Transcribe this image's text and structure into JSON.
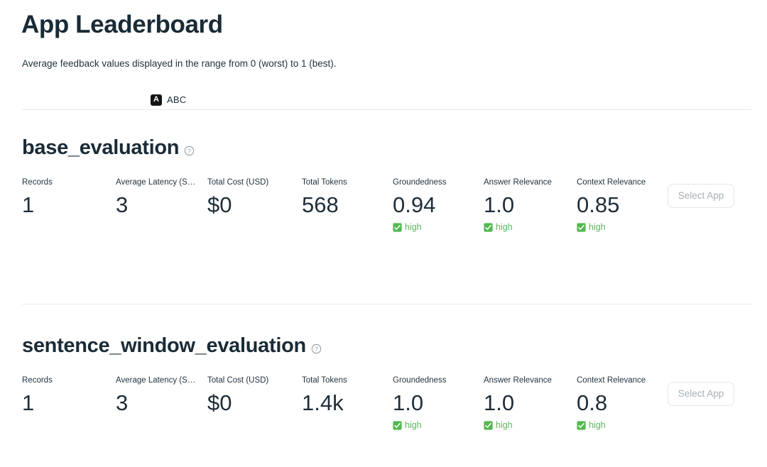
{
  "header": {
    "title": "App Leaderboard",
    "subtitle": "Average feedback values displayed in the range from 0 (worst) to 1 (best)."
  },
  "tabs": [
    {
      "badge": "A",
      "label": "ABC"
    }
  ],
  "colors": {
    "heading": "#1a2b36",
    "text": "#1f2d38",
    "positive": "#5bb85c",
    "muted": "#a7b0b6",
    "divider": "#ebebed",
    "badge_bg": "#121619"
  },
  "buttons": {
    "select_app": "Select App"
  },
  "icons": {
    "help": "help-circle-icon",
    "check": "white-heavy-check-mark-icon"
  },
  "apps": [
    {
      "name": "base_evaluation",
      "metrics": [
        {
          "label": "Records",
          "value": "1",
          "delta": null
        },
        {
          "label": "Average Latency (S…",
          "value": "3",
          "delta": null
        },
        {
          "label": "Total Cost (USD)",
          "value": "$0",
          "delta": null
        },
        {
          "label": "Total Tokens",
          "value": "568",
          "delta": null
        },
        {
          "label": "Groundedness",
          "value": "0.94",
          "delta": "high"
        },
        {
          "label": "Answer Relevance",
          "value": "1.0",
          "delta": "high"
        },
        {
          "label": "Context Relevance",
          "value": "0.85",
          "delta": "high"
        }
      ]
    },
    {
      "name": "sentence_window_evaluation",
      "metrics": [
        {
          "label": "Records",
          "value": "1",
          "delta": null
        },
        {
          "label": "Average Latency (S…",
          "value": "3",
          "delta": null
        },
        {
          "label": "Total Cost (USD)",
          "value": "$0",
          "delta": null
        },
        {
          "label": "Total Tokens",
          "value": "1.4k",
          "delta": null
        },
        {
          "label": "Groundedness",
          "value": "1.0",
          "delta": "high"
        },
        {
          "label": "Answer Relevance",
          "value": "1.0",
          "delta": "high"
        },
        {
          "label": "Context Relevance",
          "value": "0.8",
          "delta": "high"
        }
      ]
    }
  ]
}
